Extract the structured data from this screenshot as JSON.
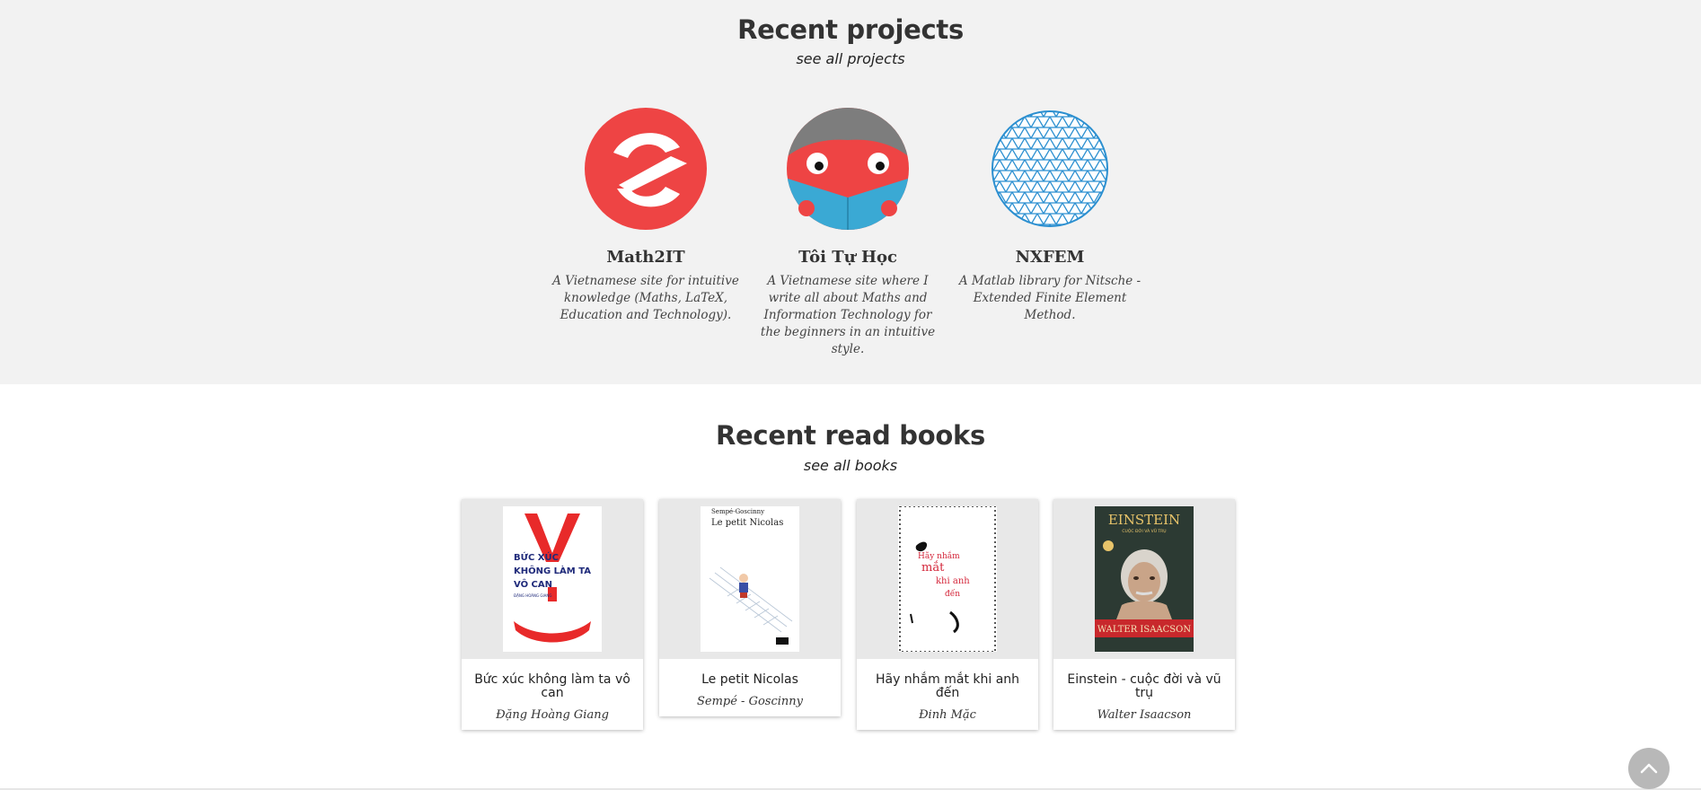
{
  "projects": {
    "title": "Recent projects",
    "see_all": "see all projects",
    "items": [
      {
        "name": "Math2IT",
        "description": "A Vietnamese site for intuitive knowledge (Maths, LaTeX, Education and Technology).",
        "logo": "math2it-logo"
      },
      {
        "name": "Tôi Tự Học",
        "description": "A Vietnamese site where I write all about Maths and Information Technology for the beginners in an intuitive style.",
        "logo": "toi-tu-hoc-logo"
      },
      {
        "name": "NXFEM",
        "description": "A Matlab library for Nitsche - Extended Finite Element Method.",
        "logo": "nxfem-mesh-logo"
      }
    ]
  },
  "books": {
    "title": "Recent read books",
    "see_all": "see all books",
    "items": [
      {
        "title": "Bức xúc không làm ta vô can",
        "author": "Đặng Hoàng Giang",
        "cover": {
          "line1": "BỨC XÚC",
          "line2": "KHÔNG LÀM TA",
          "line3": "VÔ CAN",
          "author_small": "ĐẶNG HOÀNG GIANG"
        }
      },
      {
        "title": "Le petit Nicolas",
        "author": "Sempé - Goscinny",
        "cover": {
          "line1": "Sempé-Goscinny",
          "line2": "Le petit Nicolas"
        }
      },
      {
        "title": "Hãy nhắm mắt khi anh đến",
        "author": "Đinh Mặc",
        "cover": {
          "line1": "Hãy nhắm",
          "line2": "mắt",
          "line3": "khi anh",
          "line4": "đến"
        }
      },
      {
        "title": "Einstein - cuộc đời và vũ trụ",
        "author": "Walter Isaacson",
        "cover": {
          "line1": "EINSTEIN",
          "line2": "CUỘC ĐỜI VÀ VŨ TRỤ",
          "line3": "WALTER ISAACSON"
        }
      }
    ]
  },
  "scroll_top": {
    "icon": "chevron-up-icon"
  },
  "colors": {
    "projects_bg": "#f2f2f2",
    "math2it_red": "#ee4444",
    "toi_tu_hoc_blue": "#3aa9d4",
    "nxfem_blue": "#2b8fd0"
  }
}
